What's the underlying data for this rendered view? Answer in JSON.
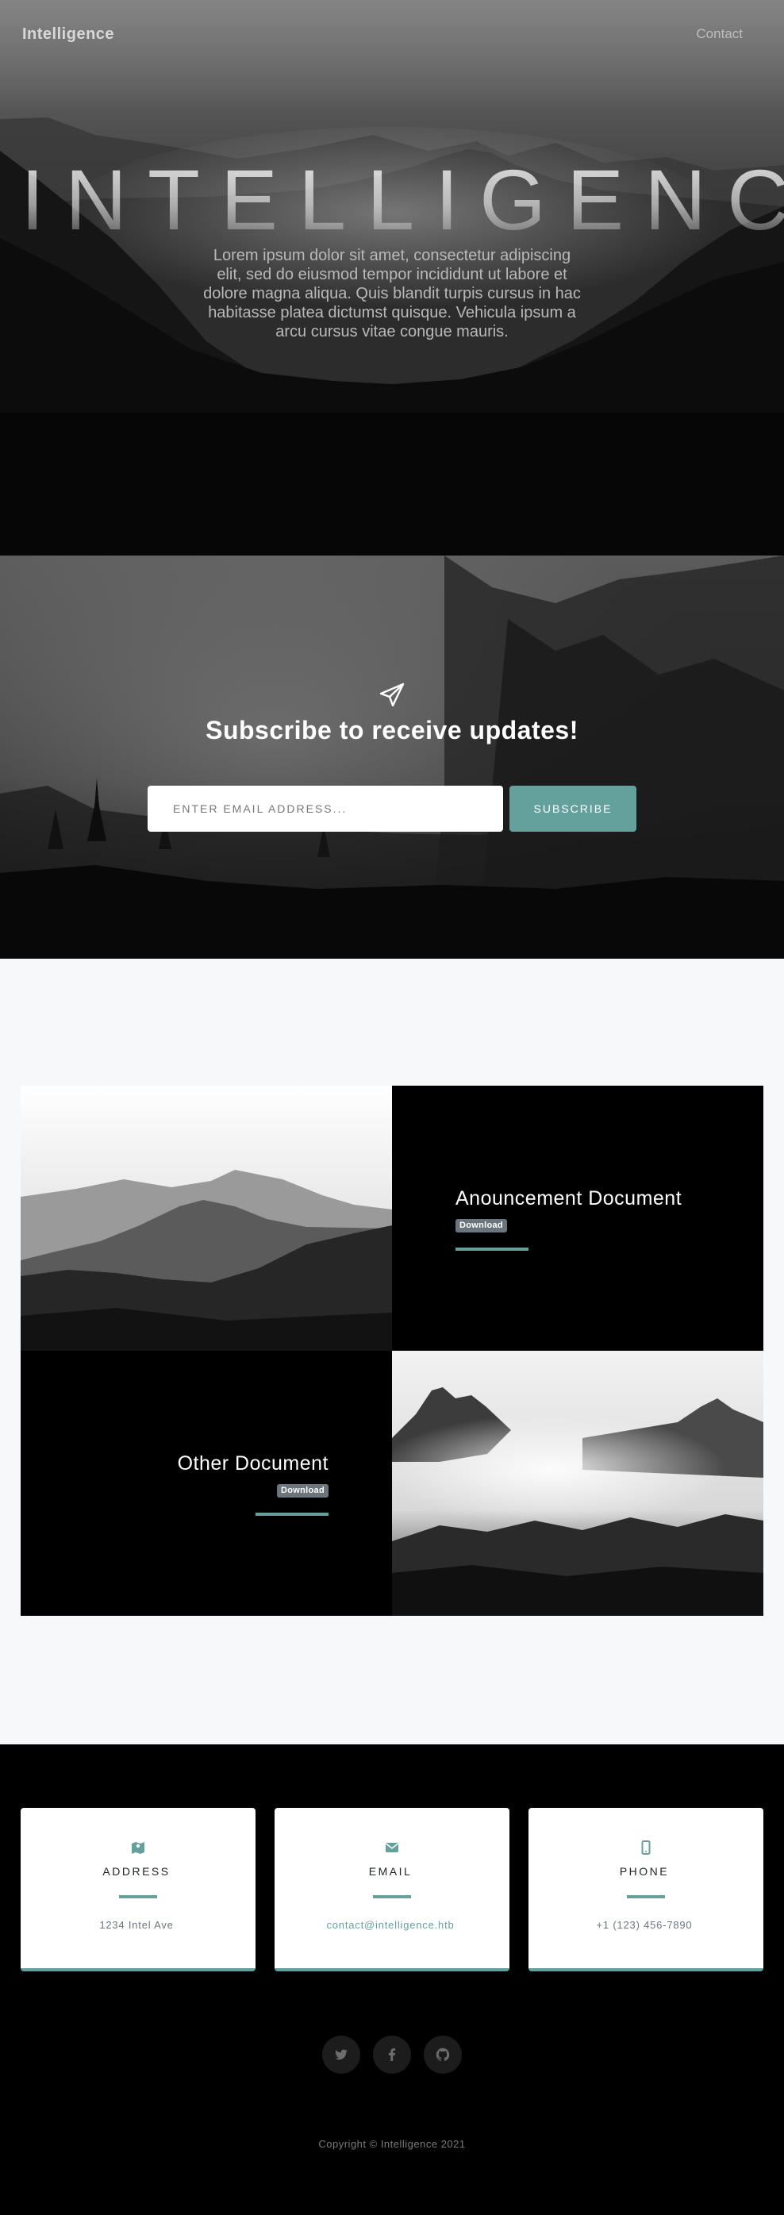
{
  "nav": {
    "brand": "Intelligence",
    "contact_link": "Contact"
  },
  "hero": {
    "title": "INTELLIGENCE",
    "text": "Lorem ipsum dolor sit amet, consectetur adipiscing elit, sed do eiusmod tempor incididunt ut labore et dolore magna aliqua. Quis blandit turpis cursus in hac habitasse platea dictumst quisque. Vehicula ipsum a arcu cursus vitae congue mauris."
  },
  "subscribe": {
    "icon": "paper-plane-icon",
    "title": "Subscribe to receive updates!",
    "email_placeholder": "ENTER EMAIL ADDRESS...",
    "button_label": "SUBSCRIBE"
  },
  "documents": [
    {
      "title": "Anouncement Document",
      "badge": "Download"
    },
    {
      "title": "Other Document",
      "badge": "Download"
    }
  ],
  "contact": {
    "cards": [
      {
        "icon": "map-icon",
        "title": "ADDRESS",
        "value": "1234 Intel Ave"
      },
      {
        "icon": "envelope-icon",
        "title": "EMAIL",
        "value": "contact@intelligence.htb"
      },
      {
        "icon": "mobile-icon",
        "title": "PHONE",
        "value": "+1 (123) 456-7890"
      }
    ],
    "social": [
      "twitter-icon",
      "facebook-icon",
      "github-icon"
    ],
    "copyright": "Copyright © Intelligence 2021"
  },
  "colors": {
    "accent": "#64a19d",
    "badge": "#6c757d",
    "light_bg": "#f7f8fa",
    "dark_bg": "#000000"
  }
}
